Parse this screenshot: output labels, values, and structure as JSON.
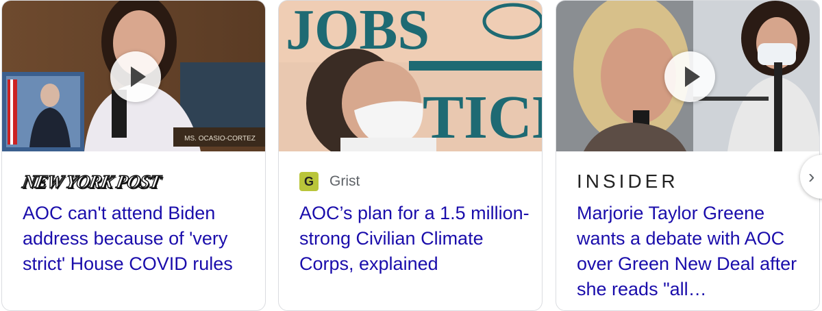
{
  "cards": [
    {
      "source": "NEW YORK POST",
      "headline": "AOC can't attend Biden address because of 'very strict' House COVID rules",
      "image_caption": "MS. OCASIO-CORTEZ",
      "has_video": true
    },
    {
      "source_icon_letter": "G",
      "source": "Grist",
      "headline": "AOC’s plan for a 1.5 million-strong Civilian Climate Corps, explained",
      "image_sign_text_1": "JOBS",
      "image_sign_text_2": "TICE",
      "has_video": false
    },
    {
      "source": "INSIDER",
      "headline": "Marjorie Taylor Greene wants a debate with AOC over Green New Deal after she reads \"all…",
      "has_video": true
    }
  ],
  "colors": {
    "headline": "#1a0dab",
    "grist_logo": "#b9c53a"
  },
  "icons": {
    "play": "play-icon",
    "next": "chevron-right-icon"
  }
}
